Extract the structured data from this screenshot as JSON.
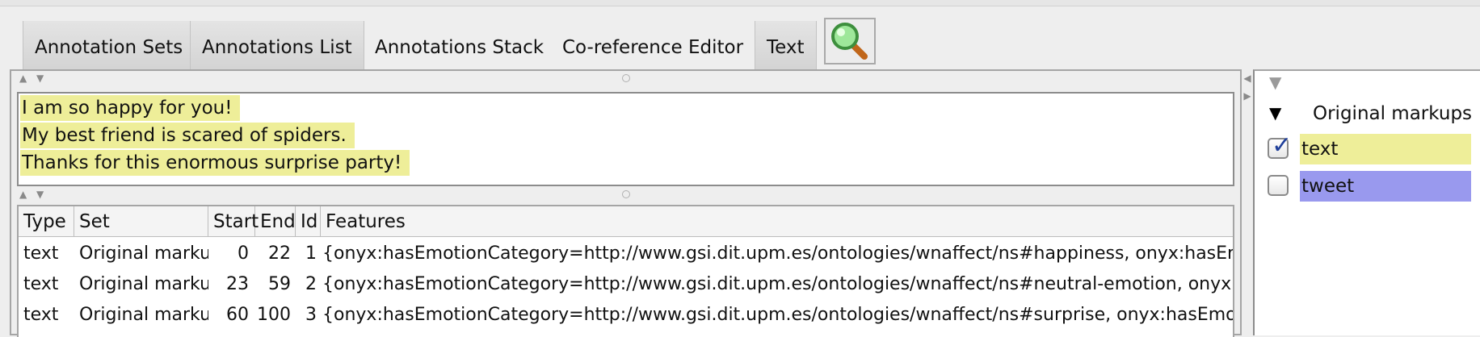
{
  "toolbar": {
    "buttons": [
      {
        "label": "Annotation Sets",
        "pressed": true
      },
      {
        "label": "Annotations List",
        "pressed": true
      },
      {
        "label": "Annotations Stack",
        "pressed": false
      },
      {
        "label": "Co-reference Editor",
        "pressed": false
      },
      {
        "label": "Text",
        "pressed": true
      }
    ],
    "search_icon": "magnifier-search-icon"
  },
  "text_panel": {
    "lines": [
      "I am so happy for you!",
      "My best friend is scared of spiders.",
      "Thanks for this enormous surprise party!"
    ],
    "highlight_color": "#eeee99"
  },
  "table": {
    "columns": [
      "Type",
      "Set",
      "Start",
      "End",
      "Id",
      "Features"
    ],
    "rows": [
      [
        "text",
        "Original markups",
        "0",
        "22",
        "1",
        "{onyx:hasEmotionCategory=http://www.gsi.dit.upm.es/ontologies/wnaffect/ns#happiness, onyx:hasEmotionIntensity"
      ],
      [
        "text",
        "Original markups",
        "23",
        "59",
        "2",
        "{onyx:hasEmotionCategory=http://www.gsi.dit.upm.es/ontologies/wnaffect/ns#neutral-emotion, onyx:hasEmotionIntensity"
      ],
      [
        "text",
        "Original markups",
        "60",
        "100",
        "3",
        "{onyx:hasEmotionCategory=http://www.gsi.dit.upm.es/ontologies/wnaffect/ns#surprise, onyx:hasEmotionIntensity"
      ]
    ]
  },
  "annotation_sets": {
    "set_name": "Original markups",
    "types": [
      {
        "label": "text",
        "checked": true,
        "color": "#eeee99"
      },
      {
        "label": "tweet",
        "checked": false,
        "color": "#9999ee"
      }
    ]
  }
}
